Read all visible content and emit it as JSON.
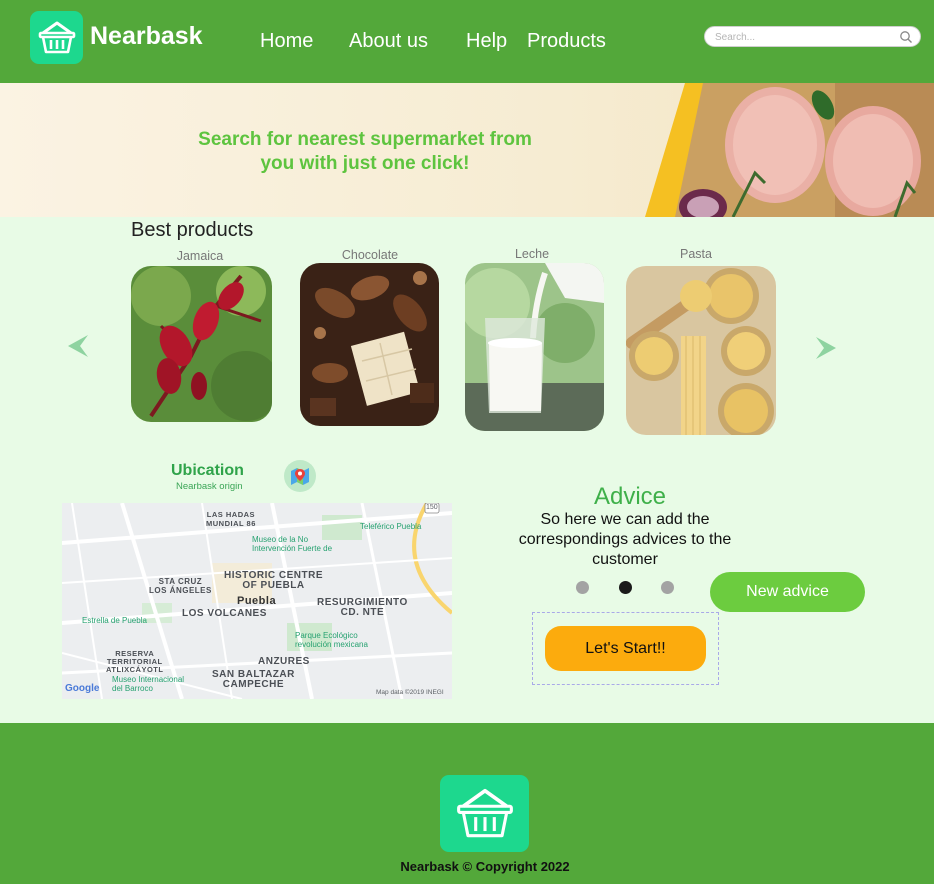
{
  "brand": {
    "name": "Nearbask"
  },
  "nav": {
    "home": "Home",
    "about": "About us",
    "help": "Help",
    "products": "Products"
  },
  "search": {
    "placeholder": "Search..."
  },
  "hero": {
    "line1": "Search for nearest supermarket from",
    "line2": "you with just one click!"
  },
  "products": {
    "title": "Best products",
    "items": [
      {
        "label": "Jamaica"
      },
      {
        "label": "Chocolate"
      },
      {
        "label": "Leche"
      },
      {
        "label": "Pasta"
      }
    ]
  },
  "ubication": {
    "title": "Ubication",
    "subtitle": "Nearbask origin",
    "map": {
      "labels": {
        "las_hadas": "LAS HADAS\nMUNDIAL 86",
        "historic": "HISTORIC CENTRE\nOF PUEBLA",
        "puebla": "Puebla",
        "sta_cruz": "STA CRUZ\nLOS ÁNGELES",
        "resurgimiento": "RESURGIMIENTO\nCD. NTE",
        "volcanes": "LOS VOLCANES",
        "anzures": "ANZURES",
        "san_baltazar": "SAN BALTAZAR\nCAMPECHE",
        "reserva": "RESERVA\nTERRITORIAL\nATLIXCÁYOTL"
      },
      "pois": {
        "teleferico": "Teleférico Puebla",
        "museo_no": "Museo de la No\nIntervención Fuerte de",
        "estrella": "Estrella de Puebla",
        "parque": "Parque Ecológico\nrevolución mexicana",
        "museo_barroco": "Museo Internacional\ndel Barroco"
      },
      "attribution": "Map data ©2019 INEGI",
      "google": "Google",
      "highway": "150"
    }
  },
  "advice": {
    "title": "Advice",
    "text": "So here we can add the correspondings advices to the customer",
    "active_dot": 2,
    "new_button": "New advice",
    "start_button": "Let's Start!!"
  },
  "footer": {
    "copyright": "Nearbask © Copyright 2022"
  },
  "colors": {
    "green": "#53a83a",
    "accent": "#1dd88e",
    "orange": "#fcab0d",
    "light_bg": "#e8fbe6"
  }
}
